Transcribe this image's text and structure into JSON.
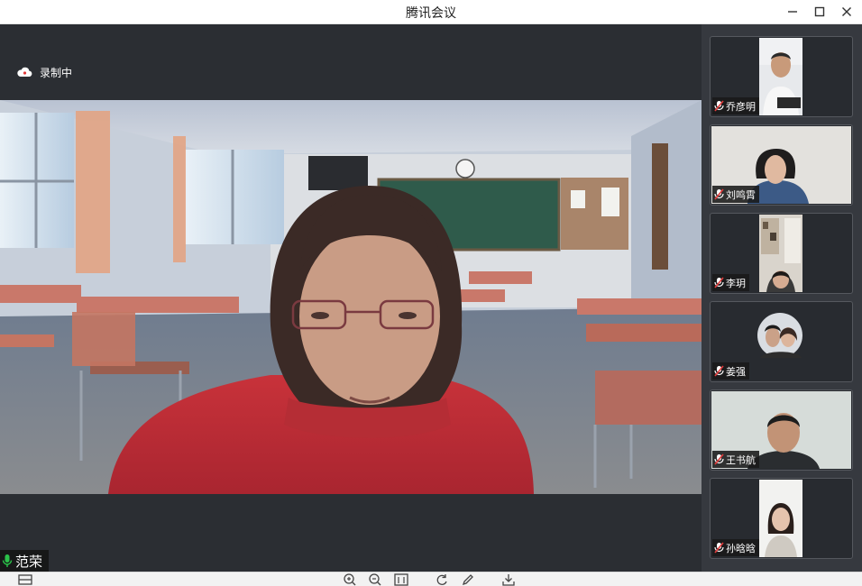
{
  "window": {
    "title": "腾讯会议"
  },
  "stage": {
    "recording_label": "录制中",
    "speaker_name": "范荣"
  },
  "participants": [
    {
      "name": "乔彦明"
    },
    {
      "name": "刘鸣霄"
    },
    {
      "name": "李玥"
    },
    {
      "name": "姜强"
    },
    {
      "name": "王书航"
    },
    {
      "name": "孙晗晗"
    }
  ],
  "icons": {
    "minimize": "minimize-icon",
    "maximize": "maximize-icon",
    "close": "close-icon",
    "cloud": "cloud-record-icon",
    "mic": "mic-icon",
    "mic_muted": "mic-muted-icon",
    "zoom_in": "zoom-in-icon",
    "zoom_out": "zoom-out-icon",
    "fit": "fit-page-icon",
    "rotate": "rotate-icon",
    "pen": "pen-icon",
    "download": "download-icon",
    "layout": "layout-icon"
  },
  "colors": {
    "stage_bg": "#2b2e33",
    "panel_bg": "#36393f",
    "mic_active": "#2bc24a",
    "mic_muted": "#e23b3b"
  }
}
